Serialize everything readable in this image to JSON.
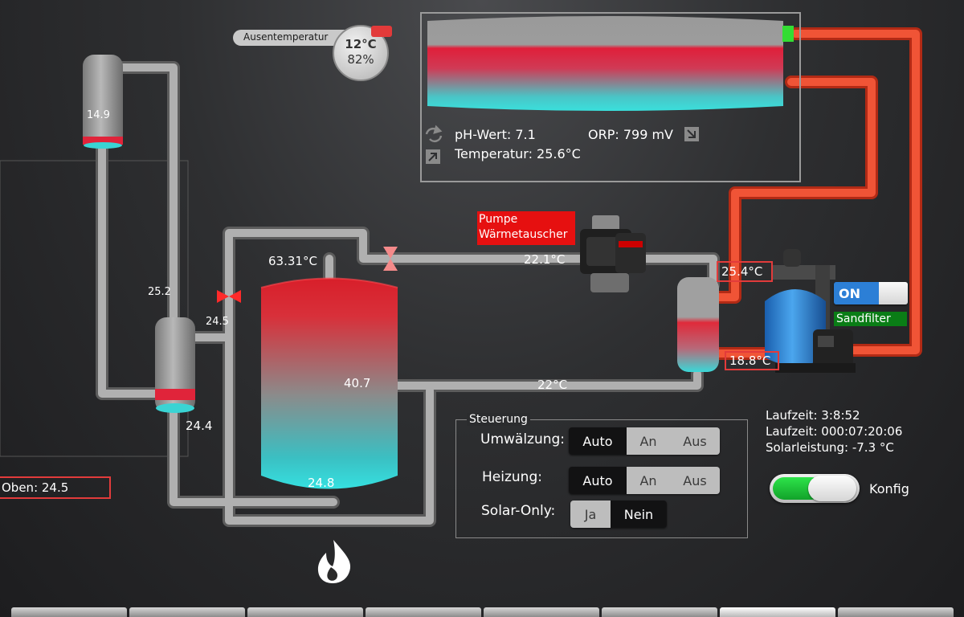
{
  "outside": {
    "label": "Ausentemperatur",
    "temp": "12°C",
    "humidity": "82%"
  },
  "pool": {
    "ph": "pH-Wert: 7.1",
    "orp": "ORP: 799 mV",
    "temp": "Temperatur: 25.6°C"
  },
  "pump": {
    "label_line1": "Pumpe",
    "label_line2": "Wärmetauscher"
  },
  "temps": {
    "collector_top": "14.9",
    "left_pipe": "25.2",
    "valve_left": "24.5",
    "exchanger_left_bottom": "24.4",
    "tank_top_out": "63.31°C",
    "tank_mid": "40.7",
    "tank_bottom": "24.8",
    "pipe_top_right": "22.1°C",
    "pipe_bottom_right": "22°C",
    "hx_right_top": "25.4°C",
    "hx_right_bottom": "18.8°C",
    "oben": "Oben: 24.5"
  },
  "sandfilter": {
    "switch_label": "ON",
    "name": "Sandfilter"
  },
  "runtime": {
    "line1": "Laufzeit: 3:8:52",
    "line2": "Laufzeit: 000:07:20:06",
    "line3": "Solarleistung: -7.3 °C"
  },
  "steuerung": {
    "title": "Steuerung",
    "umwaelzung": {
      "label": "Umwälzung:",
      "options": [
        "Auto",
        "An",
        "Aus"
      ],
      "selected": "Auto"
    },
    "heizung": {
      "label": "Heizung:",
      "options": [
        "Auto",
        "An",
        "Aus"
      ],
      "selected": "Auto"
    },
    "solar_only": {
      "label": "Solar-Only:",
      "options": [
        "Ja",
        "Nein"
      ],
      "selected": "Nein"
    }
  },
  "konfig": {
    "label": "Konfig",
    "state": "on"
  },
  "colors": {
    "pipe": "#9e9e9e",
    "hot_pipe": "#e8452a",
    "red_label": "#e61010",
    "green_label": "#0a7d16",
    "toggle_green": "#21c23a",
    "switch_blue": "#2c7fd6"
  },
  "tab_count": 8
}
